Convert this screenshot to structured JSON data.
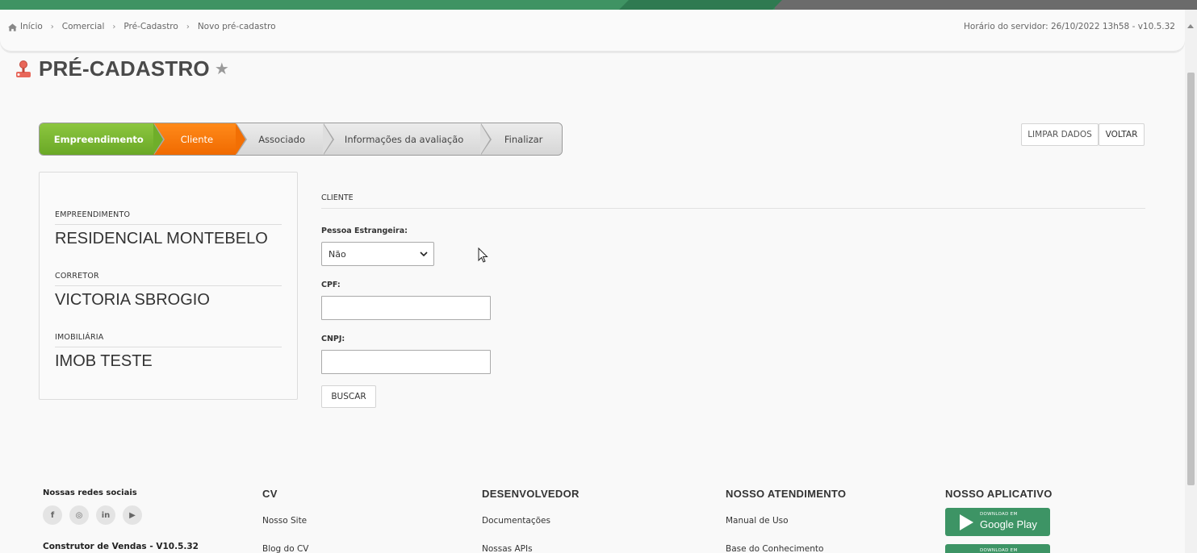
{
  "breadcrumb": {
    "items": [
      "Início",
      "Comercial",
      "Pré-Cadastro",
      "Novo pré-cadastro"
    ],
    "server_time": "Horário do servidor: 26/10/2022 13h58 - v10.5.32"
  },
  "page": {
    "title": "PRÉ-CADASTRO",
    "title_icon": "joystick-icon",
    "favorite_icon": "star-icon"
  },
  "wizard": {
    "steps": [
      {
        "label": "Empreendimento",
        "state": "done"
      },
      {
        "label": "Cliente",
        "state": "active"
      },
      {
        "label": "Associado",
        "state": "pending"
      },
      {
        "label": "Informações da avaliação",
        "state": "pending"
      },
      {
        "label": "Finalizar",
        "state": "pending"
      }
    ]
  },
  "actions": {
    "clear_label": "LIMPAR DADOS",
    "back_label": "VOLTAR"
  },
  "summary": {
    "empreendimento_label": "EMPREENDIMENTO",
    "empreendimento_value": "RESIDENCIAL MONTEBELO",
    "corretor_label": "CORRETOR",
    "corretor_value": "VICTORIA SBROGIO",
    "imobiliaria_label": "IMOBILIÁRIA",
    "imobiliaria_value": "IMOB TESTE"
  },
  "form": {
    "section_title": "CLIENTE",
    "foreign_label": "Pessoa Estrangeira:",
    "foreign_value": "Não",
    "cpf_label": "CPF:",
    "cpf_value": "",
    "cnpj_label": "CNPJ:",
    "cnpj_value": "",
    "search_label": "BUSCAR"
  },
  "footer": {
    "social_title": "Nossas redes sociais",
    "social_icons": [
      "facebook-icon",
      "instagram-icon",
      "linkedin-icon",
      "youtube-icon"
    ],
    "social_glyphs": [
      "f",
      "◎",
      "in",
      "▶"
    ],
    "version": "Construtor de Vendas - V10.5.32",
    "cv_title": "CV",
    "cv_links": [
      "Nosso Site",
      "Blog do CV"
    ],
    "dev_title": "DESENVOLVEDOR",
    "dev_links": [
      "Documentações",
      "Nossas APIs"
    ],
    "support_title": "NOSSO ATENDIMENTO",
    "support_links": [
      "Manual de Uso",
      "Base do Conhecimento"
    ],
    "app_title": "NOSSO APLICATIVO",
    "google_play_small": "DOWNLOAD EM",
    "google_play_big": "Google Play",
    "app_store_small": "DOWNLOAD EM"
  },
  "colors": {
    "step_done": "#7ab72f",
    "step_active": "#f67a0a",
    "brand_green": "#3d9465"
  }
}
